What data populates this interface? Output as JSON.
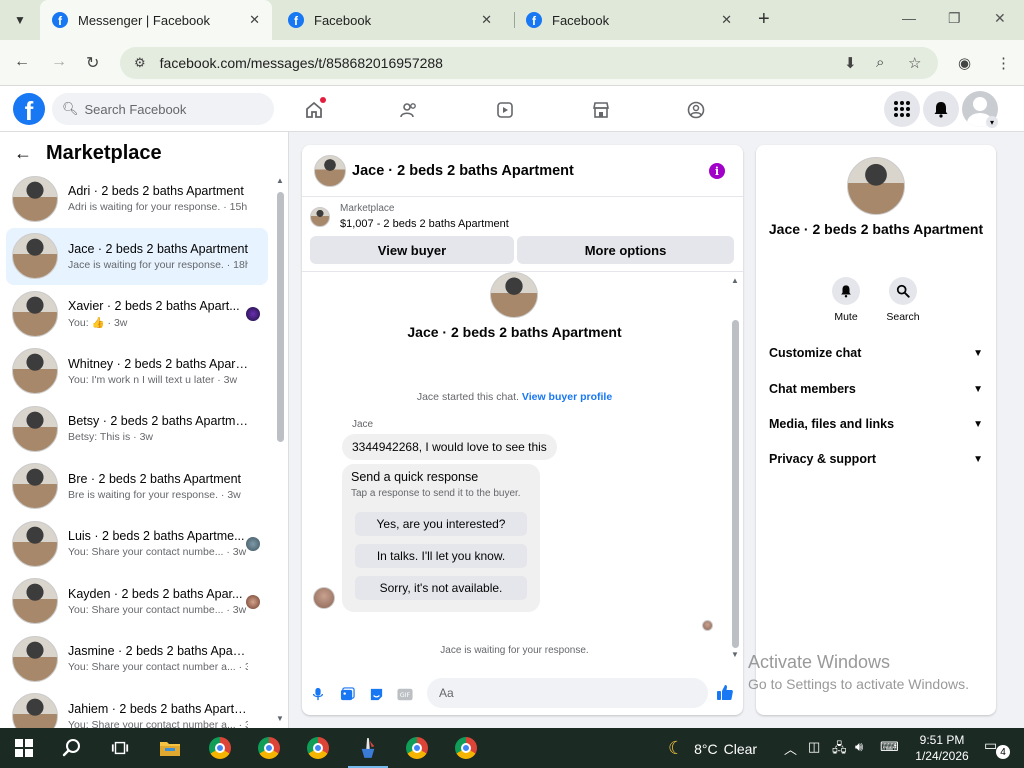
{
  "browser": {
    "tabs": [
      {
        "title": "Messenger | Facebook",
        "active": true
      },
      {
        "title": "Facebook",
        "active": false
      },
      {
        "title": "Facebook",
        "active": false
      }
    ],
    "url": "facebook.com/messages/t/858682016957288"
  },
  "fb_header": {
    "search_placeholder": "Search Facebook"
  },
  "sidebar": {
    "title": "Marketplace",
    "conversations": [
      {
        "title": "Adri · 2 beds 2 baths Apartment",
        "preview": "Adri is waiting for your response. · 15h",
        "selected": false
      },
      {
        "title": "Jace · 2 beds 2 baths Apartment",
        "preview": "Jace is waiting for your response. · 18h",
        "selected": true
      },
      {
        "title": "Xavier · 2 beds 2 baths Apart...",
        "preview": "You: 👍 · 3w",
        "selected": false
      },
      {
        "title": "Whitney · 2 beds 2 baths Apart...",
        "preview": "You: I'm work n I will text u later · 3w",
        "selected": false
      },
      {
        "title": "Betsy · 2 beds 2 baths Apartment",
        "preview": "Betsy: This is · 3w",
        "selected": false
      },
      {
        "title": "Bre · 2 beds 2 baths Apartment",
        "preview": "Bre is waiting for your response. · 3w",
        "selected": false
      },
      {
        "title": "Luis · 2 beds 2 baths Apartme...",
        "preview": "You: Share your contact numbe... · 3w",
        "selected": false
      },
      {
        "title": "Kayden · 2 beds 2 baths Apar...",
        "preview": "You: Share your contact numbe... · 3w",
        "selected": false
      },
      {
        "title": "Jasmine · 2 beds 2 baths Apart...",
        "preview": "You: Share your contact number a... · 3w",
        "selected": false
      },
      {
        "title": "Jahiem · 2 beds 2 baths Apartm...",
        "preview": "You: Share your contact number a... · 3w",
        "selected": false
      }
    ]
  },
  "chat": {
    "header_title": "Jace · 2 beds 2 baths Apartment",
    "listing_label": "Marketplace",
    "listing_price": "$1,007 - 2 beds 2 baths Apartment",
    "view_buyer": "View buyer",
    "more_options": "More options",
    "thread_title": "Jace · 2 beds 2 baths Apartment",
    "started_text": "Jace started this chat.",
    "view_profile_link": "View buyer profile",
    "sender_name": "Jace",
    "message": "3344942268, I would love to see this",
    "quick_title": "Send a quick response",
    "quick_sub": "Tap a response to send it to the buyer.",
    "quick_responses": [
      "Yes, are you interested?",
      "In talks. I'll let you know.",
      "Sorry, it's not available."
    ],
    "waiting_text": "Jace is waiting for your response.",
    "composer_placeholder": "Aa"
  },
  "info_panel": {
    "name": "Jace · 2 beds 2 baths Apartment",
    "mute": "Mute",
    "search": "Search",
    "sections": [
      "Customize chat",
      "Chat members",
      "Media, files and links",
      "Privacy & support"
    ]
  },
  "watermark": {
    "line1": "Activate Windows",
    "line2": "Go to Settings to activate Windows."
  },
  "taskbar": {
    "temperature": "8°C",
    "weather": "Clear",
    "time": "9:51 PM",
    "date": "1/24/2026",
    "notifications": "4"
  },
  "colors": {
    "fb_blue": "#1877f2",
    "selected_bg": "#e7f3ff",
    "info_purple": "#a000c8"
  }
}
